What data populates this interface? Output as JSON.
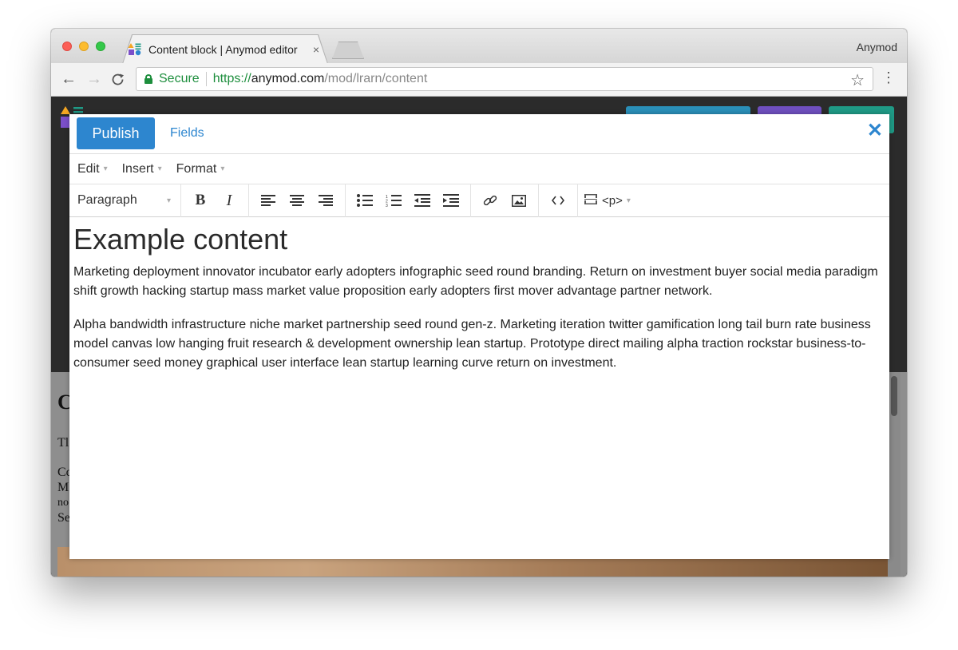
{
  "browser": {
    "tab_title": "Content block | Anymod editor",
    "tab_close": "×",
    "profile_name": "Anymod",
    "secure_label": "Secure",
    "url_scheme": "https://",
    "url_host": "anymod.com",
    "url_path": "/mod/lrarn/content"
  },
  "editor": {
    "publish_label": "Publish",
    "fields_label": "Fields",
    "close_glyph": "✕",
    "menus": [
      "Edit",
      "Insert",
      "Format"
    ],
    "block_format": "Paragraph",
    "tag_indicator": "<p>",
    "caret": "▾"
  },
  "content": {
    "heading": "Example content",
    "paragraphs": [
      "Marketing deployment innovator incubator early adopters infographic seed round branding. Return on investment buyer social media paradigm shift growth hacking startup mass market value proposition early adopters first mover advantage partner network.",
      "Alpha bandwidth infrastructure niche market partnership seed round gen-z. Marketing iteration twitter gamification long tail burn rate business model canvas low hanging fruit research & development ownership lean startup. Prototype direct mailing alpha traction rockstar business-to-consumer seed money graphical user interface lean startup learning curve return on investment."
    ]
  },
  "background_page": {
    "letters": [
      "C",
      "Tl",
      "Co",
      "M",
      "no",
      "Se"
    ]
  },
  "colors": {
    "accent": "#2d86cf",
    "secure_green": "#1d8e3d"
  }
}
